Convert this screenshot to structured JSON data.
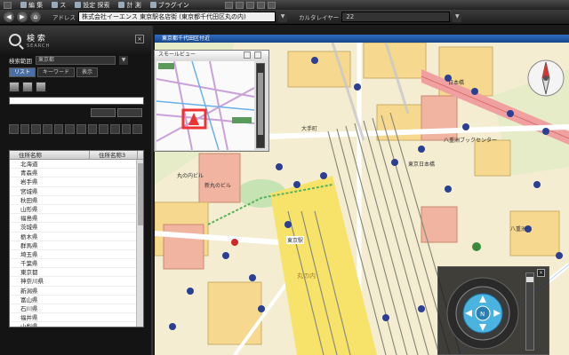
{
  "menu": {
    "items": [
      {
        "label": "編 集",
        "icon": "edit-icon"
      },
      {
        "label": "ス",
        "icon": "tool-icon"
      },
      {
        "label": "設定 探索",
        "icon": "settings-icon"
      },
      {
        "label": "計 測",
        "icon": "measure-icon"
      },
      {
        "label": "ブラグイン",
        "icon": "plugin-icon"
      }
    ]
  },
  "addressbar": {
    "address_label": "アドレス",
    "address_value": "株式会社イーエンス 東京駅名店街 (東京都千代田区丸の内)",
    "layer_label": "カルタレイヤー",
    "layer_value": "22"
  },
  "search": {
    "title": "検 索",
    "subtitle": "SEARCH",
    "range_label": "検索範囲",
    "range_value": "東京都",
    "tabs": [
      "リスト",
      "キーワード",
      "表示"
    ],
    "keyword": "",
    "columns": [
      "住所名称",
      "住所名称3"
    ],
    "results": [
      "北海道",
      "青森県",
      "岩手県",
      "宮城県",
      "秋田県",
      "山形県",
      "福島県",
      "茨城県",
      "栃木県",
      "群馬県",
      "埼玉県",
      "千葉県",
      "東京都",
      "神奈川県",
      "新潟県",
      "富山県",
      "石川県",
      "福井県",
      "山梨県"
    ]
  },
  "map": {
    "title": "東京都千代田区付近",
    "small_view_title": "スモールビュー",
    "labels": [
      "丸の内ビル",
      "東京駅",
      "丸の内",
      "東京日本橋",
      "日本橋",
      "八重洲",
      "大手町",
      "新丸のビル",
      "八重洲ブックセンター"
    ]
  },
  "colors": {
    "accent": "#2f6cc4",
    "road": "#f0a0a0",
    "building": "#f6d88e",
    "water": "#9fc6e8"
  }
}
